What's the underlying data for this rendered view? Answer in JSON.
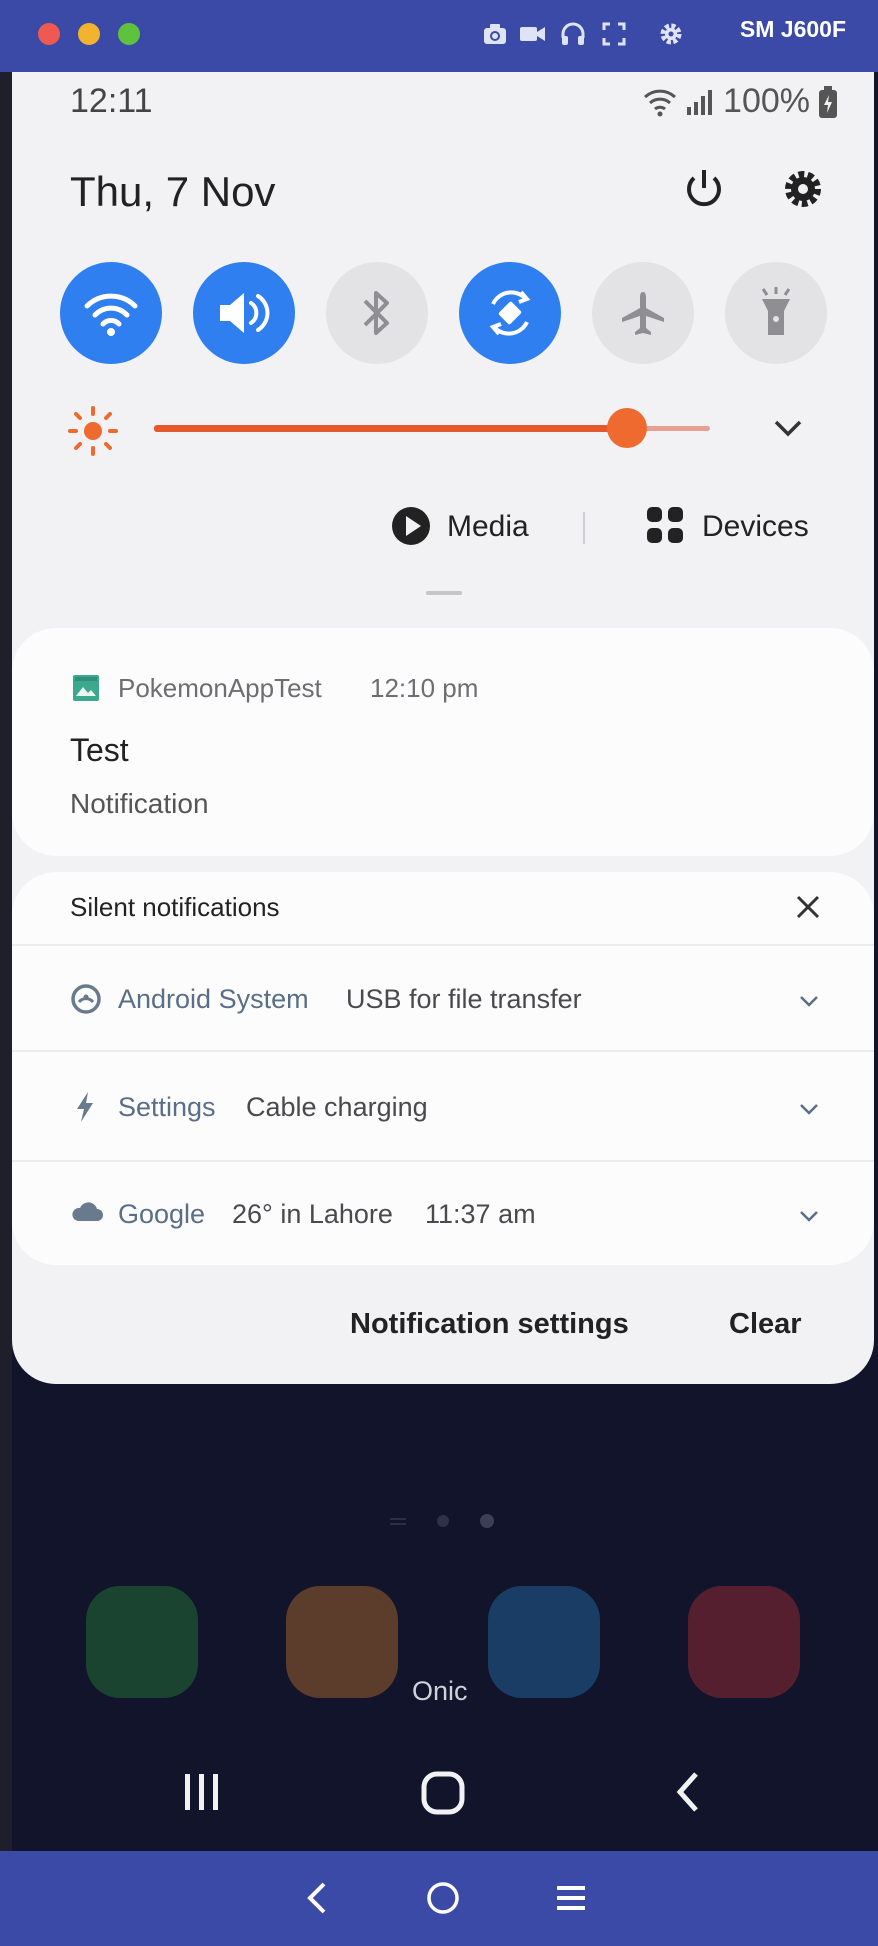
{
  "window": {
    "device_name": "SM J600F",
    "icons": [
      "camera-icon",
      "video-icon",
      "headphones-icon",
      "fullscreen-icon",
      "gear-icon"
    ],
    "nav": [
      "back-icon",
      "home-circle-icon",
      "menu-icon"
    ]
  },
  "status_bar": {
    "time": "12:11",
    "battery": "100%"
  },
  "quick_panel": {
    "date": "Thu, 7 Nov",
    "toggles": [
      {
        "name": "wifi",
        "on": true
      },
      {
        "name": "sound",
        "on": true
      },
      {
        "name": "bluetooth",
        "on": false
      },
      {
        "name": "auto-rotate",
        "on": true
      },
      {
        "name": "airplane",
        "on": false
      },
      {
        "name": "flashlight",
        "on": false
      }
    ],
    "brightness_level": 0.85,
    "media_label": "Media",
    "devices_label": "Devices"
  },
  "notification": {
    "app": "PokemonAppTest",
    "time": "12:10 pm",
    "title": "Test",
    "text": "Notification"
  },
  "silent": {
    "title": "Silent notifications",
    "rows": [
      {
        "app": "Android System",
        "text": "USB for file transfer",
        "icon": "android-system-icon"
      },
      {
        "app": "Settings",
        "text": "Cable charging",
        "icon": "bolt-icon"
      },
      {
        "app": "Google",
        "text": "26° in Lahore",
        "time": "11:37 am",
        "icon": "cloud-icon"
      }
    ]
  },
  "footer": {
    "settings_label": "Notification settings",
    "clear_label": "Clear"
  },
  "home": {
    "folder_label": "Onic"
  },
  "colors": {
    "accent": "#2f7ff0",
    "brightness": "#ee6a2e",
    "chrome": "#3b4aa6"
  }
}
